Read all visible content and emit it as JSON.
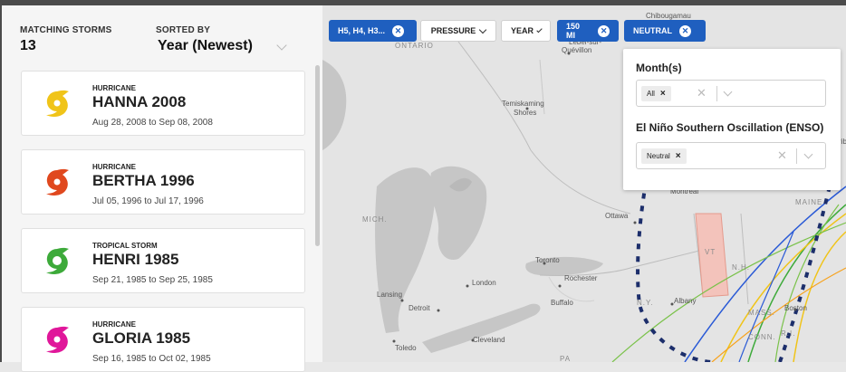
{
  "sidebar": {
    "matching_label": "MATCHING STORMS",
    "matching_count": "13",
    "sorted_label": "SORTED BY",
    "sorted_value": "Year (Newest)",
    "storms": [
      {
        "type": "HURRICANE",
        "name": "HANNA 2008",
        "dates": "Aug 28, 2008 to Sep 08, 2008",
        "color": "#f0c419"
      },
      {
        "type": "HURRICANE",
        "name": "BERTHA 1996",
        "dates": "Jul 05, 1996 to Jul 17, 1996",
        "color": "#e0481e"
      },
      {
        "type": "TROPICAL STORM",
        "name": "HENRI 1985",
        "dates": "Sep 21, 1985 to Sep 25, 1985",
        "color": "#3daa3a"
      },
      {
        "type": "HURRICANE",
        "name": "GLORIA 1985",
        "dates": "Sep 16, 1985 to Oct 02, 1985",
        "color": "#e0179a"
      }
    ]
  },
  "filters": {
    "category": "H5, H4, H3...",
    "pressure": "PRESSURE",
    "year": "YEAR",
    "distance": "150 MI",
    "enso": "NEUTRAL"
  },
  "popover": {
    "month_label": "Month(s)",
    "month_tag": "All",
    "enso_label": "El Niño Southern Oscillation (ENSO)",
    "enso_tag": "Neutral"
  },
  "map_labels": {
    "chibougamau": "Chibougamau",
    "lebel": "Lebel-sur-",
    "quevillon": "Quévillon",
    "temiskaming": "Temiskaming",
    "shores": "Shores",
    "ontario": "ONTARIO",
    "mich": "MICH.",
    "ottawa": "Ottawa",
    "montreal": "Montreal",
    "maine": "MAINE",
    "toronto": "Toronto",
    "rochester": "Rochester",
    "london": "London",
    "buffalo": "Buffalo",
    "lansing": "Lansing",
    "detroit": "Detroit",
    "ny": "N.Y.",
    "albany": "Albany",
    "vt": "VT",
    "nh": "N.H.",
    "mass": "MASS.",
    "boston": "Boston",
    "toledo": "Toledo",
    "cleveland": "Cleveland",
    "pa": "PA",
    "ri": "R.I.",
    "conn": "CONN.",
    "rib": "rib"
  },
  "colors": {
    "chip_blue": "#1f5fbf",
    "track_dashed": "#1c2e6b",
    "vermont_highlight": "#f3c3bb"
  }
}
